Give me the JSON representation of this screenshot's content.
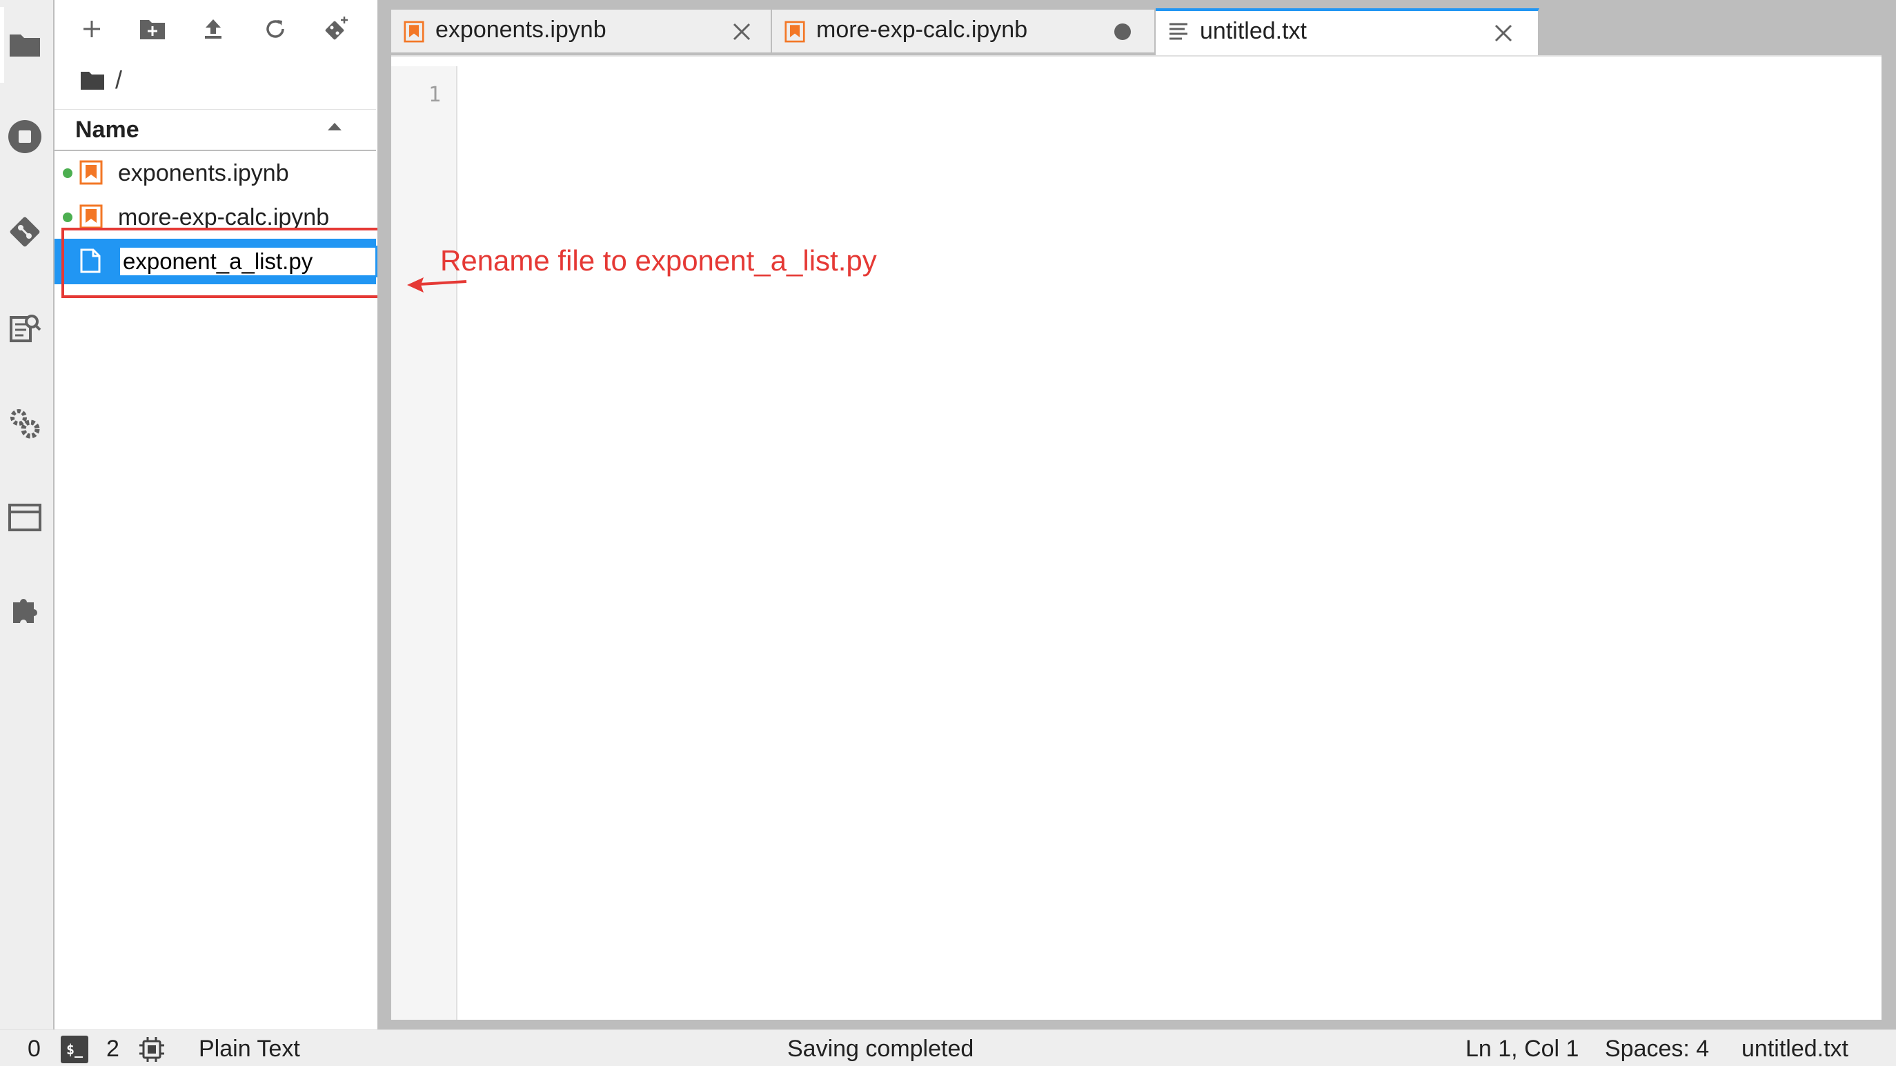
{
  "activity_bar": {
    "icons": [
      "folder-icon",
      "running-icon",
      "git-icon",
      "property-inspector-icon",
      "settings-icon",
      "tabs-icon",
      "extension-icon"
    ]
  },
  "file_browser": {
    "toolbar": [
      "new-launcher-icon",
      "new-folder-icon",
      "upload-icon",
      "refresh-icon",
      "git-clone-icon"
    ],
    "breadcrumb": "/",
    "header": {
      "name": "Name"
    },
    "files": [
      {
        "name": "exponents.ipynb",
        "type": "notebook",
        "running": true
      },
      {
        "name": "more-exp-calc.ipynb",
        "type": "notebook",
        "running": true
      }
    ],
    "rename": {
      "value": "exponent_a_list.py"
    }
  },
  "tabs": [
    {
      "label": "exponents.ipynb",
      "type": "notebook",
      "status": "close"
    },
    {
      "label": "more-exp-calc.ipynb",
      "type": "notebook",
      "status": "unsaved"
    },
    {
      "label": "untitled.txt",
      "type": "text",
      "status": "close",
      "active": true
    }
  ],
  "editor": {
    "line_numbers": [
      "1"
    ]
  },
  "annotation": {
    "text": "Rename file to exponent_a_list.py",
    "color": "#e53935"
  },
  "status_bar": {
    "count_a": "0",
    "count_b": "2",
    "mode": "Plain Text",
    "message": "Saving completed",
    "cursor": "Ln 1, Col 1",
    "spaces": "Spaces: 4",
    "filename": "untitled.txt"
  },
  "colors": {
    "accent": "#2196f3",
    "notebook_icon": "#f37726",
    "running": "#4caf50",
    "annotation": "#e53935"
  }
}
